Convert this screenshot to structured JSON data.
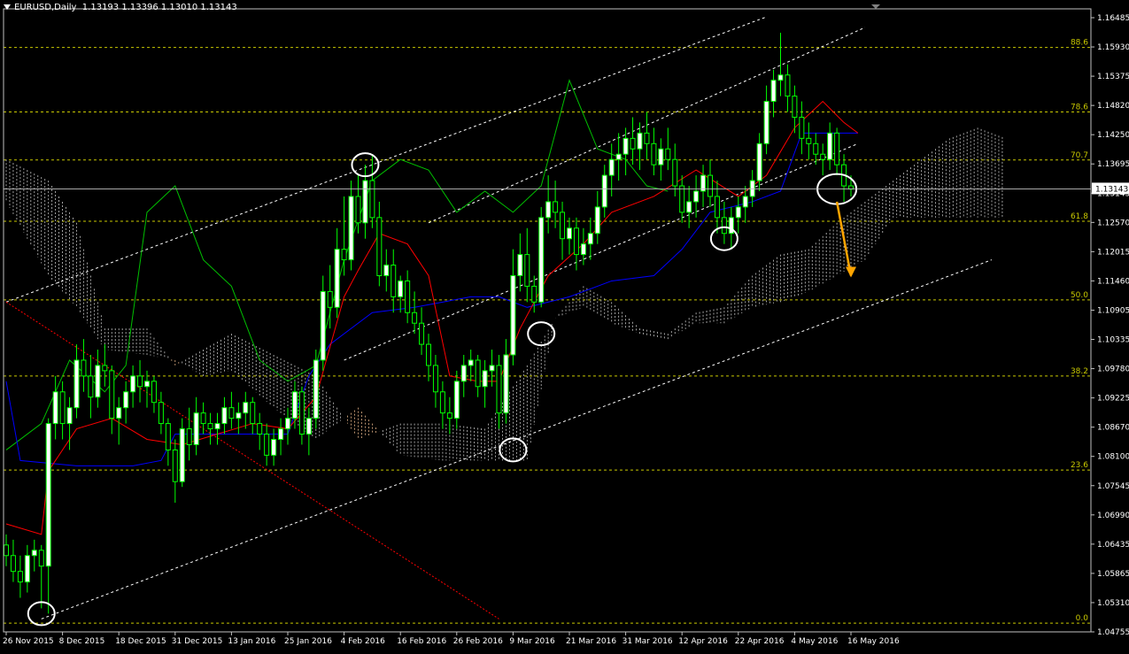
{
  "window": {
    "symbol_label": "EURUSD,Daily",
    "ohlc": "1.13193 1.13396 1.13010 1.13143"
  },
  "colors": {
    "background": "#000000",
    "bull": "#00ff00",
    "tenkan": "#ff0000",
    "kijun": "#0000ff",
    "chikou": "#00c000",
    "cloud_a": "#e8b78a",
    "cloud_b": "#c8c8c8",
    "fib": "#c8c800",
    "channel": "#ffffff",
    "arrow": "#ffa500",
    "axis": "#c0c0c0"
  },
  "chart_data": {
    "type": "candlestick",
    "symbol": "EURUSD",
    "timeframe": "Daily",
    "current_price": 1.13143,
    "current_price_label": "1.13143",
    "y_ticks": [
      "1.16485",
      "1.15930",
      "1.15375",
      "1.14820",
      "1.14250",
      "1.13695",
      "1.13143",
      "1.12570",
      "1.12015",
      "1.11460",
      "1.10905",
      "1.10335",
      "1.09780",
      "1.09225",
      "1.08670",
      "1.08100",
      "1.07545",
      "1.06990",
      "1.06435",
      "1.05865",
      "1.05310",
      "1.04755"
    ],
    "ylim": [
      1.04755,
      1.16485
    ],
    "x_tick_labels": [
      "26 Nov 2015",
      "8 Dec 2015",
      "18 Dec 2015",
      "31 Dec 2015",
      "13 Jan 2016",
      "25 Jan 2016",
      "4 Feb 2016",
      "16 Feb 2016",
      "26 Feb 2016",
      "9 Mar 2016",
      "21 Mar 2016",
      "31 Mar 2016",
      "12 Apr 2016",
      "22 Apr 2016",
      "4 May 2016",
      "16 May 2016"
    ],
    "x_tick_index": [
      0,
      8,
      16,
      24,
      32,
      40,
      48,
      56,
      64,
      72,
      80,
      88,
      96,
      104,
      112,
      120
    ],
    "fib_levels": [
      {
        "label": "88.6",
        "price": 1.1582
      },
      {
        "label": "78.6",
        "price": 1.146
      },
      {
        "label": "70.7",
        "price": 1.1369
      },
      {
        "label": "61.8",
        "price": 1.1253
      },
      {
        "label": "50.0",
        "price": 1.1104
      },
      {
        "label": "38.2",
        "price": 1.096
      },
      {
        "label": "23.6",
        "price": 1.0782
      },
      {
        "label": "0.0",
        "price": 1.0492
      }
    ],
    "candles": [
      [
        1.064,
        1.066,
        1.06,
        1.062
      ],
      [
        1.062,
        1.065,
        1.057,
        1.059
      ],
      [
        1.059,
        1.062,
        1.054,
        1.057
      ],
      [
        1.057,
        1.064,
        1.055,
        1.062
      ],
      [
        1.062,
        1.065,
        1.059,
        1.063
      ],
      [
        1.063,
        1.064,
        1.052,
        1.06
      ],
      [
        1.06,
        1.088,
        1.051,
        1.087
      ],
      [
        1.087,
        1.096,
        1.084,
        1.093
      ],
      [
        1.093,
        1.095,
        1.084,
        1.087
      ],
      [
        1.087,
        1.092,
        1.082,
        1.09
      ],
      [
        1.09,
        1.102,
        1.088,
        1.099
      ],
      [
        1.099,
        1.103,
        1.093,
        1.096
      ],
      [
        1.096,
        1.1,
        1.088,
        1.092
      ],
      [
        1.092,
        1.101,
        1.09,
        1.098
      ],
      [
        1.098,
        1.102,
        1.094,
        1.097
      ],
      [
        1.097,
        1.098,
        1.085,
        1.088
      ],
      [
        1.088,
        1.092,
        1.083,
        1.09
      ],
      [
        1.09,
        1.095,
        1.087,
        1.093
      ],
      [
        1.093,
        1.098,
        1.09,
        1.096
      ],
      [
        1.096,
        1.099,
        1.091,
        1.094
      ],
      [
        1.094,
        1.097,
        1.09,
        1.095
      ],
      [
        1.095,
        1.096,
        1.089,
        1.091
      ],
      [
        1.091,
        1.093,
        1.085,
        1.087
      ],
      [
        1.087,
        1.088,
        1.079,
        1.082
      ],
      [
        1.082,
        1.084,
        1.072,
        1.076
      ],
      [
        1.076,
        1.088,
        1.075,
        1.086
      ],
      [
        1.086,
        1.09,
        1.08,
        1.083
      ],
      [
        1.083,
        1.092,
        1.081,
        1.089
      ],
      [
        1.089,
        1.091,
        1.085,
        1.087
      ],
      [
        1.087,
        1.089,
        1.083,
        1.086
      ],
      [
        1.086,
        1.089,
        1.083,
        1.087
      ],
      [
        1.087,
        1.092,
        1.085,
        1.09
      ],
      [
        1.09,
        1.093,
        1.086,
        1.088
      ],
      [
        1.088,
        1.091,
        1.085,
        1.089
      ],
      [
        1.089,
        1.093,
        1.086,
        1.091
      ],
      [
        1.091,
        1.092,
        1.085,
        1.087
      ],
      [
        1.087,
        1.089,
        1.082,
        1.085
      ],
      [
        1.085,
        1.087,
        1.079,
        1.081
      ],
      [
        1.081,
        1.086,
        1.079,
        1.084
      ],
      [
        1.084,
        1.088,
        1.081,
        1.086
      ],
      [
        1.086,
        1.09,
        1.083,
        1.088
      ],
      [
        1.088,
        1.095,
        1.086,
        1.093
      ],
      [
        1.093,
        1.094,
        1.083,
        1.085
      ],
      [
        1.085,
        1.09,
        1.081,
        1.088
      ],
      [
        1.088,
        1.101,
        1.086,
        1.099
      ],
      [
        1.099,
        1.115,
        1.097,
        1.112
      ],
      [
        1.112,
        1.117,
        1.105,
        1.109
      ],
      [
        1.109,
        1.124,
        1.107,
        1.12
      ],
      [
        1.12,
        1.13,
        1.115,
        1.118
      ],
      [
        1.118,
        1.133,
        1.116,
        1.13
      ],
      [
        1.13,
        1.134,
        1.123,
        1.125
      ],
      [
        1.125,
        1.136,
        1.122,
        1.133
      ],
      [
        1.133,
        1.138,
        1.124,
        1.126
      ],
      [
        1.126,
        1.129,
        1.113,
        1.115
      ],
      [
        1.115,
        1.12,
        1.112,
        1.117
      ],
      [
        1.117,
        1.12,
        1.108,
        1.111
      ],
      [
        1.111,
        1.115,
        1.108,
        1.114
      ],
      [
        1.114,
        1.116,
        1.106,
        1.108
      ],
      [
        1.108,
        1.112,
        1.104,
        1.106
      ],
      [
        1.106,
        1.109,
        1.1,
        1.102
      ],
      [
        1.102,
        1.104,
        1.095,
        1.098
      ],
      [
        1.098,
        1.1,
        1.09,
        1.093
      ],
      [
        1.093,
        1.095,
        1.086,
        1.089
      ],
      [
        1.089,
        1.092,
        1.085,
        1.088
      ],
      [
        1.088,
        1.097,
        1.086,
        1.095
      ],
      [
        1.095,
        1.1,
        1.092,
        1.098
      ],
      [
        1.098,
        1.101,
        1.095,
        1.099
      ],
      [
        1.099,
        1.1,
        1.092,
        1.094
      ],
      [
        1.094,
        1.099,
        1.09,
        1.097
      ],
      [
        1.097,
        1.101,
        1.094,
        1.098
      ],
      [
        1.098,
        1.1,
        1.086,
        1.089
      ],
      [
        1.089,
        1.103,
        1.087,
        1.1
      ],
      [
        1.1,
        1.12,
        1.098,
        1.115
      ],
      [
        1.115,
        1.123,
        1.112,
        1.119
      ],
      [
        1.119,
        1.124,
        1.11,
        1.113
      ],
      [
        1.113,
        1.115,
        1.108,
        1.11
      ],
      [
        1.11,
        1.128,
        1.109,
        1.126
      ],
      [
        1.126,
        1.134,
        1.123,
        1.129
      ],
      [
        1.129,
        1.133,
        1.124,
        1.127
      ],
      [
        1.127,
        1.129,
        1.118,
        1.122
      ],
      [
        1.122,
        1.126,
        1.119,
        1.124
      ],
      [
        1.124,
        1.126,
        1.116,
        1.119
      ],
      [
        1.119,
        1.124,
        1.117,
        1.121
      ],
      [
        1.121,
        1.126,
        1.118,
        1.123
      ],
      [
        1.123,
        1.131,
        1.121,
        1.128
      ],
      [
        1.128,
        1.136,
        1.126,
        1.134
      ],
      [
        1.134,
        1.14,
        1.13,
        1.137
      ],
      [
        1.137,
        1.142,
        1.133,
        1.138
      ],
      [
        1.138,
        1.143,
        1.134,
        1.141
      ],
      [
        1.141,
        1.145,
        1.136,
        1.139
      ],
      [
        1.139,
        1.144,
        1.135,
        1.142
      ],
      [
        1.142,
        1.146,
        1.137,
        1.14
      ],
      [
        1.14,
        1.143,
        1.134,
        1.136
      ],
      [
        1.136,
        1.141,
        1.133,
        1.139
      ],
      [
        1.139,
        1.143,
        1.135,
        1.137
      ],
      [
        1.137,
        1.14,
        1.13,
        1.132
      ],
      [
        1.132,
        1.134,
        1.125,
        1.127
      ],
      [
        1.127,
        1.132,
        1.124,
        1.129
      ],
      [
        1.129,
        1.134,
        1.126,
        1.131
      ],
      [
        1.131,
        1.136,
        1.128,
        1.134
      ],
      [
        1.134,
        1.137,
        1.128,
        1.13
      ],
      [
        1.13,
        1.133,
        1.123,
        1.126
      ],
      [
        1.126,
        1.129,
        1.121,
        1.123
      ],
      [
        1.123,
        1.128,
        1.12,
        1.126
      ],
      [
        1.126,
        1.13,
        1.123,
        1.128
      ],
      [
        1.128,
        1.132,
        1.125,
        1.13
      ],
      [
        1.13,
        1.135,
        1.128,
        1.133
      ],
      [
        1.133,
        1.142,
        1.131,
        1.14
      ],
      [
        1.14,
        1.151,
        1.138,
        1.148
      ],
      [
        1.148,
        1.154,
        1.145,
        1.152
      ],
      [
        1.152,
        1.161,
        1.149,
        1.153
      ],
      [
        1.153,
        1.155,
        1.146,
        1.149
      ],
      [
        1.149,
        1.151,
        1.142,
        1.145
      ],
      [
        1.145,
        1.148,
        1.138,
        1.141
      ],
      [
        1.141,
        1.144,
        1.137,
        1.14
      ],
      [
        1.14,
        1.142,
        1.136,
        1.138
      ],
      [
        1.138,
        1.14,
        1.134,
        1.137
      ],
      [
        1.137,
        1.144,
        1.135,
        1.142
      ],
      [
        1.142,
        1.143,
        1.134,
        1.136
      ],
      [
        1.136,
        1.138,
        1.129,
        1.132
      ],
      [
        1.132,
        1.134,
        1.13,
        1.1314
      ]
    ],
    "tenkan": [
      [
        0,
        1.068
      ],
      [
        5,
        1.066
      ],
      [
        6,
        1.078
      ],
      [
        10,
        1.086
      ],
      [
        15,
        1.088
      ],
      [
        20,
        1.084
      ],
      [
        25,
        1.083
      ],
      [
        30,
        1.085
      ],
      [
        35,
        1.087
      ],
      [
        40,
        1.086
      ],
      [
        44,
        1.092
      ],
      [
        48,
        1.111
      ],
      [
        50,
        1.116
      ],
      [
        53,
        1.123
      ],
      [
        57,
        1.121
      ],
      [
        60,
        1.115
      ],
      [
        63,
        1.096
      ],
      [
        67,
        1.095
      ],
      [
        70,
        1.095
      ],
      [
        73,
        1.105
      ],
      [
        77,
        1.115
      ],
      [
        82,
        1.121
      ],
      [
        86,
        1.127
      ],
      [
        92,
        1.13
      ],
      [
        98,
        1.135
      ],
      [
        104,
        1.13
      ],
      [
        108,
        1.134
      ],
      [
        112,
        1.143
      ],
      [
        116,
        1.148
      ],
      [
        119,
        1.144
      ],
      [
        121,
        1.142
      ]
    ],
    "kijun": [
      [
        0,
        1.095
      ],
      [
        2,
        1.08
      ],
      [
        10,
        1.079
      ],
      [
        18,
        1.079
      ],
      [
        22,
        1.08
      ],
      [
        24,
        1.085
      ],
      [
        36,
        1.085
      ],
      [
        40,
        1.085
      ],
      [
        43,
        1.096
      ],
      [
        46,
        1.102
      ],
      [
        52,
        1.108
      ],
      [
        58,
        1.109
      ],
      [
        62,
        1.11
      ],
      [
        66,
        1.111
      ],
      [
        70,
        1.111
      ],
      [
        74,
        1.109
      ],
      [
        80,
        1.111
      ],
      [
        86,
        1.114
      ],
      [
        92,
        1.115
      ],
      [
        96,
        1.12
      ],
      [
        100,
        1.127
      ],
      [
        106,
        1.129
      ],
      [
        110,
        1.131
      ],
      [
        113,
        1.142
      ],
      [
        118,
        1.142
      ],
      [
        121,
        1.142
      ]
    ],
    "chikou": [
      [
        0,
        1.082
      ],
      [
        5,
        1.087
      ],
      [
        9,
        1.099
      ],
      [
        14,
        1.093
      ],
      [
        17,
        1.098
      ],
      [
        20,
        1.127
      ],
      [
        24,
        1.132
      ],
      [
        28,
        1.118
      ],
      [
        32,
        1.113
      ],
      [
        36,
        1.099
      ],
      [
        40,
        1.095
      ],
      [
        44,
        1.098
      ],
      [
        48,
        1.118
      ],
      [
        52,
        1.133
      ],
      [
        56,
        1.137
      ],
      [
        60,
        1.135
      ],
      [
        64,
        1.127
      ],
      [
        68,
        1.131
      ],
      [
        72,
        1.127
      ],
      [
        76,
        1.132
      ],
      [
        80,
        1.152
      ],
      [
        84,
        1.139
      ],
      [
        88,
        1.137
      ],
      [
        91,
        1.132
      ],
      [
        94,
        1.131
      ]
    ],
    "cloud": [
      [
        0,
        1.137,
        1.129
      ],
      [
        6,
        1.133,
        1.115
      ],
      [
        10,
        1.125,
        1.109
      ],
      [
        14,
        1.105,
        1.101
      ],
      [
        20,
        1.105,
        1.1
      ],
      [
        24,
        1.098,
        1.099
      ],
      [
        28,
        1.101,
        1.096
      ],
      [
        32,
        1.104,
        1.097
      ],
      [
        38,
        1.1,
        1.09
      ],
      [
        44,
        1.096,
        1.084
      ],
      [
        50,
        1.084,
        1.09
      ],
      [
        56,
        1.087,
        1.081
      ],
      [
        62,
        1.087,
        1.08
      ],
      [
        68,
        1.086,
        1.08
      ],
      [
        74,
        1.098,
        1.08
      ],
      [
        78,
        1.107,
        1.107
      ],
      [
        82,
        1.113,
        1.109
      ],
      [
        86,
        1.11,
        1.106
      ],
      [
        90,
        1.105,
        1.104
      ],
      [
        94,
        1.104,
        1.103
      ],
      [
        98,
        1.108,
        1.106
      ],
      [
        102,
        1.109,
        1.106
      ],
      [
        106,
        1.115,
        1.109
      ],
      [
        110,
        1.119,
        1.11
      ],
      [
        114,
        1.12,
        1.112
      ],
      [
        118,
        1.125,
        1.115
      ],
      [
        122,
        1.129,
        1.118
      ],
      [
        126,
        1.133,
        1.126
      ],
      [
        130,
        1.137,
        1.126
      ],
      [
        134,
        1.141,
        1.126
      ],
      [
        138,
        1.143,
        1.126
      ],
      [
        142,
        1.141,
        1.126
      ]
    ],
    "channels": [
      {
        "p1": [
          5,
          1.05
        ],
        "p2": [
          140,
          1.118
        ]
      },
      {
        "p1": [
          0,
          1.11
        ],
        "p2": [
          108,
          1.164
        ]
      },
      {
        "p1": [
          48,
          1.099
        ],
        "p2": [
          121,
          1.14
        ]
      },
      {
        "p1": [
          60,
          1.125
        ],
        "p2": [
          122,
          1.162
        ]
      }
    ],
    "red_dotted_line": {
      "p1": [
        0,
        1.11
      ],
      "p2": [
        70,
        1.05
      ]
    },
    "circles": [
      [
        5,
        1.051
      ],
      [
        51,
        1.136
      ],
      [
        72,
        1.082
      ],
      [
        76,
        1.104
      ],
      [
        102,
        1.122
      ],
      [
        118,
        1.1314
      ]
    ],
    "arrow": {
      "from": [
        118,
        1.129
      ],
      "to": [
        120,
        1.115
      ]
    }
  }
}
